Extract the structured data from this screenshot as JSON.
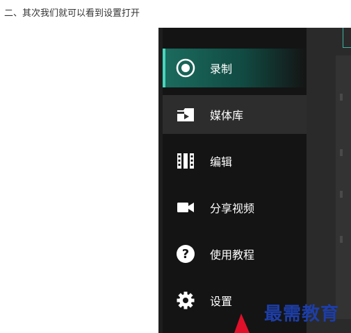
{
  "caption": "二、其次我们就可以看到设置打开",
  "sidebar": {
    "items": [
      {
        "label": "录制",
        "icon": "record-icon",
        "state": "active"
      },
      {
        "label": "媒体库",
        "icon": "media-library-icon",
        "state": "hover"
      },
      {
        "label": "编辑",
        "icon": "film-edit-icon",
        "state": "normal"
      },
      {
        "label": "分享视频",
        "icon": "video-camera-icon",
        "state": "normal"
      },
      {
        "label": "使用教程",
        "icon": "help-icon",
        "state": "normal"
      },
      {
        "label": "设置",
        "icon": "gear-icon",
        "state": "normal"
      }
    ]
  },
  "watermark": "最需教育",
  "colors": {
    "accent": "#47d6bd",
    "sidebar_bg": "#141414",
    "arrow": "#e0102a",
    "watermark": "#1d3ea8"
  }
}
